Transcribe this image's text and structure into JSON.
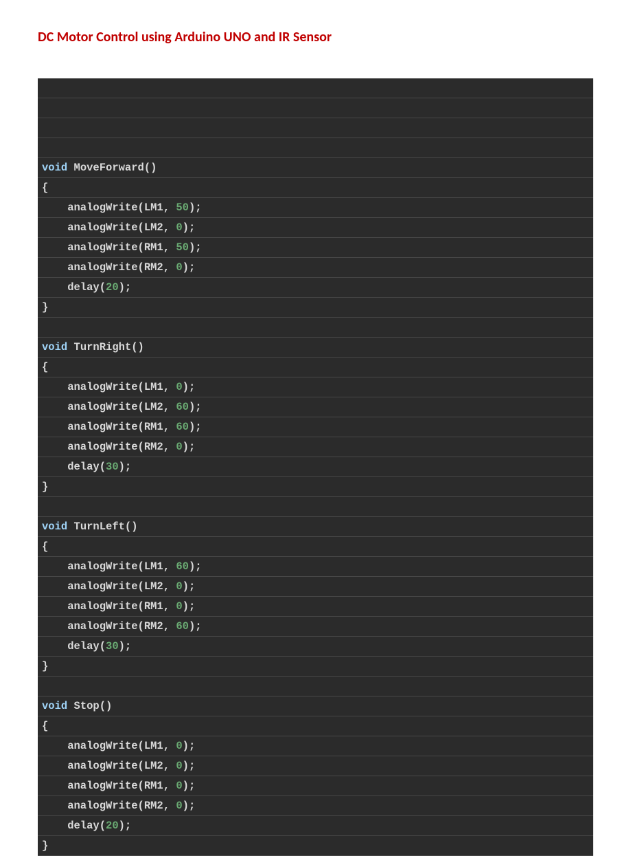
{
  "title": "DC Motor Control using Arduino UNO and IR Sensor",
  "code": {
    "blank0": " ",
    "blank1": " ",
    "blank2": " ",
    "blank3": " ",
    "fn1": {
      "sig_void": "void",
      "sig_name": " MoveForward()",
      "open": "{",
      "l1a": "    analogWrite(LM1, ",
      "l1n": "50",
      "l1b": ");",
      "l2a": "    analogWrite(LM2, ",
      "l2n": "0",
      "l2b": ");",
      "l3a": "    analogWrite(RM1, ",
      "l3n": "50",
      "l3b": ");",
      "l4a": "    analogWrite(RM2, ",
      "l4n": "0",
      "l4b": ");",
      "l5a": "    delay(",
      "l5n": "20",
      "l5b": ");",
      "close": "}"
    },
    "fn2": {
      "sig_void": "void",
      "sig_name": " TurnRight()",
      "open": "{",
      "l1a": "    analogWrite(LM1, ",
      "l1n": "0",
      "l1b": ");",
      "l2a": "    analogWrite(LM2, ",
      "l2n": "60",
      "l2b": ");",
      "l3a": "    analogWrite(RM1, ",
      "l3n": "60",
      "l3b": ");",
      "l4a": "    analogWrite(RM2, ",
      "l4n": "0",
      "l4b": ");",
      "l5a": "    delay(",
      "l5n": "30",
      "l5b": ");",
      "close": "}"
    },
    "fn3": {
      "sig_void": "void",
      "sig_name": " TurnLeft()",
      "open": "{",
      "l1a": "    analogWrite(LM1, ",
      "l1n": "60",
      "l1b": ");",
      "l2a": "    analogWrite(LM2, ",
      "l2n": "0",
      "l2b": ");",
      "l3a": "    analogWrite(RM1, ",
      "l3n": "0",
      "l3b": ");",
      "l4a": "    analogWrite(RM2, ",
      "l4n": "60",
      "l4b": ");",
      "l5a": "    delay(",
      "l5n": "30",
      "l5b": ");",
      "close": "}"
    },
    "fn4": {
      "sig_void": "void",
      "sig_name": " Stop()",
      "open": "{",
      "l1a": "    analogWrite(LM1, ",
      "l1n": "0",
      "l1b": ");",
      "l2a": "    analogWrite(LM2, ",
      "l2n": "0",
      "l2b": ");",
      "l3a": "    analogWrite(RM1, ",
      "l3n": "0",
      "l3b": ");",
      "l4a": "    analogWrite(RM2, ",
      "l4n": "0",
      "l4b": ");",
      "l5a": "    delay(",
      "l5n": "20",
      "l5b": ");",
      "close": "}"
    }
  }
}
